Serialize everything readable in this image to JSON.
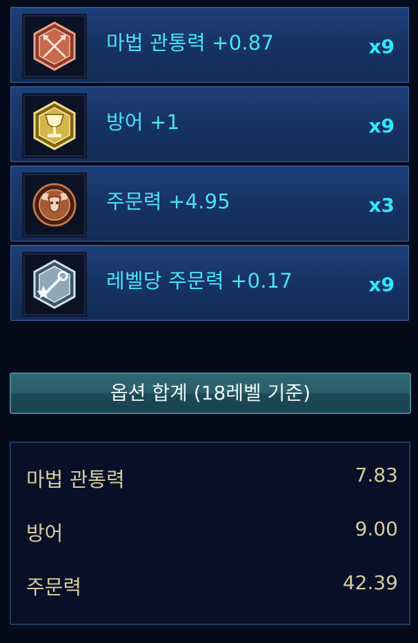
{
  "runes": [
    {
      "label": "마법 관통력 +0.87",
      "count": "x9",
      "icon": "crossed-arrows-icon",
      "color": "#c8684b"
    },
    {
      "label": "방어 +1",
      "count": "x9",
      "icon": "chalice-icon",
      "color": "#d4b54a"
    },
    {
      "label": "주문력 +4.95",
      "count": "x3",
      "icon": "ram-skull-icon",
      "color": "#a95b33"
    },
    {
      "label": "레벨당 주문력 +0.17",
      "count": "x9",
      "icon": "wand-key-icon",
      "color": "#8ea8b8"
    }
  ],
  "summary": {
    "title": "옵션 합계 (18레벨 기준)"
  },
  "stats": [
    {
      "name": "마법 관통력",
      "value": "7.83"
    },
    {
      "name": "방어",
      "value": "9.00"
    },
    {
      "name": "주문력",
      "value": "42.39"
    }
  ],
  "colors": {
    "background": "#060b1a",
    "rune_row": "#173466",
    "rune_text": "#49e3f5",
    "summary_button": "#2a5f69",
    "stat_text": "#d8cba0"
  }
}
